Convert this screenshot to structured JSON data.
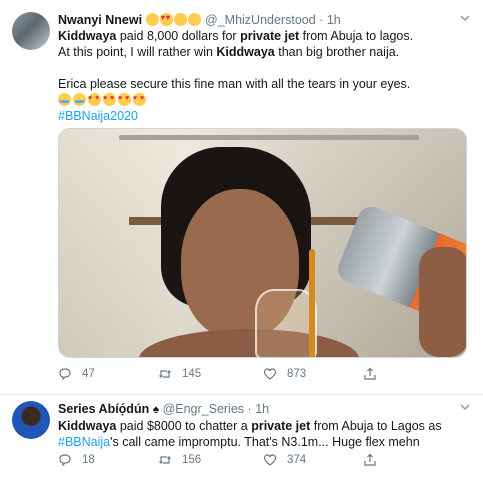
{
  "tweets": [
    {
      "author": "Nwanyi Nnewi",
      "name_emojis": [
        "face-blowing-kiss",
        "heart-eyes",
        "kissing-face",
        "hands-over-face"
      ],
      "handle": "@_MhizUnderstood",
      "separator": "·",
      "time": "1h",
      "lines": [
        [
          "Kiddwaya",
          " paid 8,000 dollars for ",
          "private jet",
          " from Abuja to lagos."
        ],
        [
          "At this point, I will rather win ",
          "Kiddwaya",
          " than big brother naija."
        ],
        [
          "Erica please secure this fine man with all the tears in your eyes."
        ]
      ],
      "emoji_row": [
        "crying-laughing",
        "crying-laughing",
        "heart-eyes",
        "heart-eyes",
        "heart-eyes",
        "heart-eyes"
      ],
      "hashtag": "#BBNaija2020",
      "media_alt": "man pouring drink from can into glass",
      "actions": {
        "replies": "47",
        "retweets": "145",
        "likes": "873"
      }
    },
    {
      "author": "Series Abíọ́dún",
      "name_emoji": "spade-suit",
      "handle": "@Engr_Series",
      "separator": "·",
      "time": "1h",
      "lines": [
        [
          "Kiddwaya",
          " paid $8000 to chatter a ",
          "private jet",
          " from Abuja to Lagos as"
        ],
        [
          "#BBNaija",
          "'s call came impromptu. That's N3.1m... Huge flex mehn"
        ]
      ],
      "actions": {
        "replies": "18",
        "retweets": "156",
        "likes": "374"
      }
    }
  ],
  "icons": {
    "reply": "reply-icon",
    "retweet": "retweet-icon",
    "like": "heart-icon",
    "share": "share-icon",
    "more": "chevron-down-icon"
  },
  "colors": {
    "link": "#1da1f2",
    "secondary": "#657786",
    "text": "#14171a",
    "border": "#e6ecf0"
  }
}
